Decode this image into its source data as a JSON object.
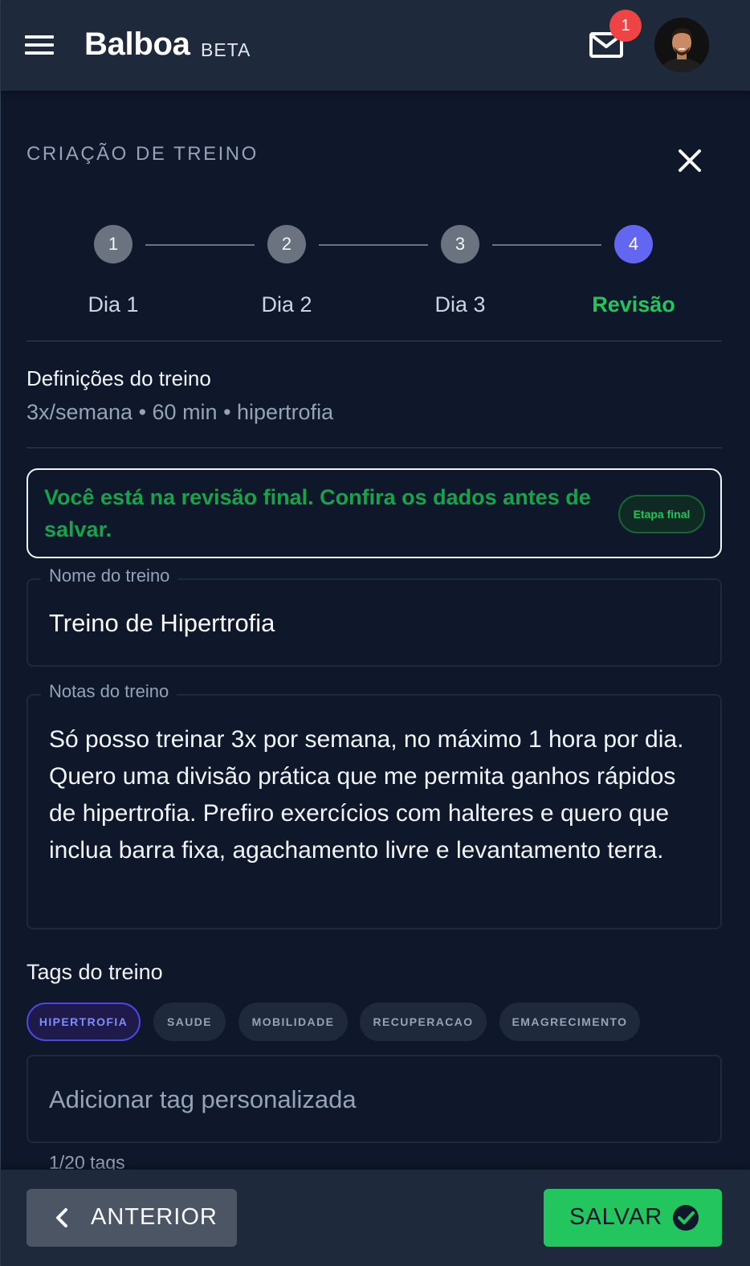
{
  "header": {
    "brand": "Balboa",
    "beta_label": "BETA",
    "notification_count": "1",
    "icons": {
      "menu": "hamburger-menu-icon",
      "mail": "mail-icon",
      "avatar": "user-avatar"
    }
  },
  "page": {
    "section_title": "CRIAÇÃO DE TREINO",
    "close_icon": "close-icon"
  },
  "stepper": {
    "active_index": 3,
    "active_color": "#6366f1",
    "active_label_color": "#22c55e",
    "steps": [
      {
        "number": "1",
        "label": "Dia 1"
      },
      {
        "number": "2",
        "label": "Dia 2"
      },
      {
        "number": "3",
        "label": "Dia 3"
      },
      {
        "number": "4",
        "label": "Revisão"
      }
    ]
  },
  "definitions": {
    "title": "Definições do treino",
    "summary": "3x/semana • 60 min • hipertrofia"
  },
  "notice": {
    "text": "Você está na revisão final. Confira os dados antes de salvar.",
    "chip": "Etapa final",
    "color": "#16a34a"
  },
  "form": {
    "name_label": "Nome do treino",
    "name_value": "Treino de Hipertrofia",
    "notes_label": "Notas do treino",
    "notes_value": "Só posso treinar 3x por semana, no máximo 1 hora por dia. Quero uma divisão prática que me permita ganhos rápidos de hipertrofia. Prefiro exercícios com halteres e quero que inclua barra fixa, agachamento livre e levantamento terra."
  },
  "tags": {
    "title": "Tags do treino",
    "items": [
      {
        "label": "HIPERTROFIA",
        "selected": true
      },
      {
        "label": "SAUDE",
        "selected": false
      },
      {
        "label": "MOBILIDADE",
        "selected": false
      },
      {
        "label": "RECUPERACAO",
        "selected": false
      },
      {
        "label": "EMAGRECIMENTO",
        "selected": false
      }
    ],
    "input_placeholder": "Adicionar tag personalizada",
    "count": "1/20 tags"
  },
  "footer": {
    "prev_label": "ANTERIOR",
    "save_label": "SALVAR",
    "save_color": "#22c55e",
    "icons": {
      "prev": "chevron-left-icon",
      "save": "check-circle-icon"
    }
  }
}
